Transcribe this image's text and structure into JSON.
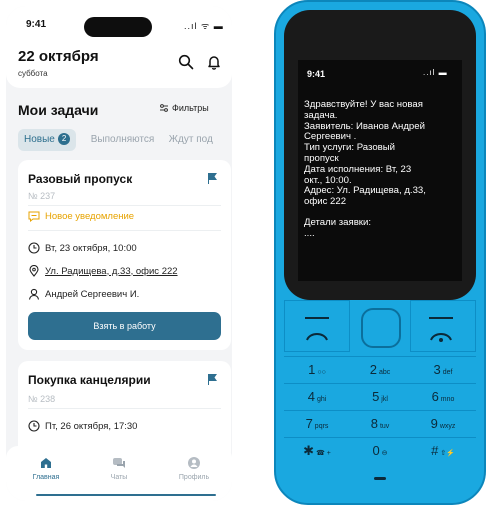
{
  "app": {
    "status_time": "9:41",
    "status_icons": "..ıl ᯤ ▬",
    "header": {
      "date": "22 октября",
      "weekday": "суббота"
    },
    "section_title": "Мои задачи",
    "filters_label": "Фильтры",
    "tabs": [
      {
        "label": "Новые",
        "badge": "2"
      },
      {
        "label": "Выполняются"
      },
      {
        "label": "Ждут под"
      }
    ],
    "cards": [
      {
        "title": "Разовый пропуск",
        "number": "№ 237",
        "notification": "Новое уведомление",
        "datetime": "Вт, 23 октября, 10:00",
        "address": "Ул. Радищева, д.33, офис 222",
        "person": "Андрей Сергеевич И.",
        "button": "Взять в работу"
      },
      {
        "title": "Покупка канцелярии",
        "number": "№ 238",
        "datetime": "Пт, 26 октября, 17:30"
      }
    ],
    "tabbar": [
      {
        "label": "Главная"
      },
      {
        "label": "Чаты"
      },
      {
        "label": "Профиль"
      }
    ]
  },
  "feature_phone": {
    "status_time": "9:41",
    "signal": "..ıl ▬",
    "message_lines": [
      "Здравствуйте! У вас новая",
      "задача.",
      "Заявитель: Иванов Андрей",
      "Сергеевич .",
      "Тип услуги: Разовый",
      "пропуск",
      "Дата исполнения: Вт, 23",
      "окт., 10:00.",
      "Адрес: Ул. Радищева, д.33,",
      "офис 222"
    ],
    "details_title": "Детали заявки:",
    "details_more": "....",
    "keys": [
      {
        "num": "1",
        "sub": "○○"
      },
      {
        "num": "2",
        "sub": "abc"
      },
      {
        "num": "3",
        "sub": "def"
      },
      {
        "num": "4",
        "sub": "ghi"
      },
      {
        "num": "5",
        "sub": "jkl"
      },
      {
        "num": "6",
        "sub": "mno"
      },
      {
        "num": "7",
        "sub": "pqrs"
      },
      {
        "num": "8",
        "sub": "tuv"
      },
      {
        "num": "9",
        "sub": "wxyz"
      },
      {
        "num": "✱",
        "sub": "☎ +"
      },
      {
        "num": "0",
        "sub": "⊖"
      },
      {
        "num": "#",
        "sub": "⇧⚡"
      }
    ]
  },
  "colors": {
    "accent": "#2e6f90",
    "notify": "#e7a300",
    "phone_body": "#1aa8e0"
  }
}
